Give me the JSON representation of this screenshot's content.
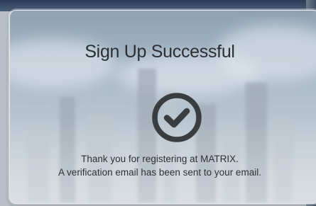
{
  "dialog": {
    "title": "Sign Up Successful",
    "icon": "check-circle-icon",
    "message_line1": "Thank you for registering at MATRIX.",
    "message_line2": "A verification email has been sent to your email."
  },
  "colors": {
    "text": "#2b2f33",
    "icon": "#3a3d40"
  }
}
